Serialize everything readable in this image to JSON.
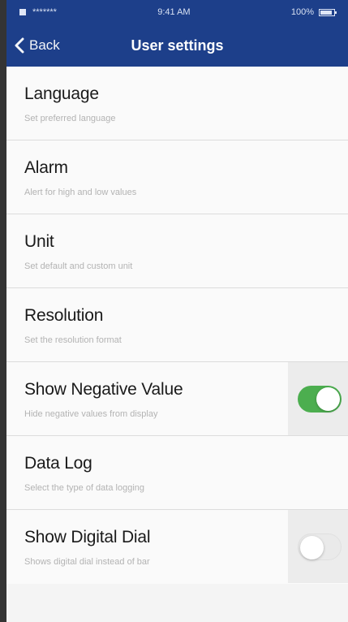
{
  "colors": {
    "accent": "#1d3f8a",
    "toggle_on": "#4cae4f"
  },
  "status_bar": {
    "carrier": "*******",
    "time": "9:41 AM",
    "battery": "100%"
  },
  "nav": {
    "back_label": "Back",
    "back_icon": "chevron-left-icon",
    "title": "User settings"
  },
  "settings": [
    {
      "title": "Language",
      "description": "Set preferred language"
    },
    {
      "title": "Alarm",
      "description": "Alert for high and low values"
    },
    {
      "title": "Unit",
      "description": "Set default and custom unit"
    },
    {
      "title": "Resolution",
      "description": "Set the resolution format"
    },
    {
      "title": "Show Negative Value",
      "description": "Hide negative values from display",
      "toggle": true
    },
    {
      "title": "Data Log",
      "description": "Select the type of data logging"
    },
    {
      "title": "Show Digital Dial",
      "description": "Shows digital dial instead of bar",
      "toggle": false
    }
  ]
}
